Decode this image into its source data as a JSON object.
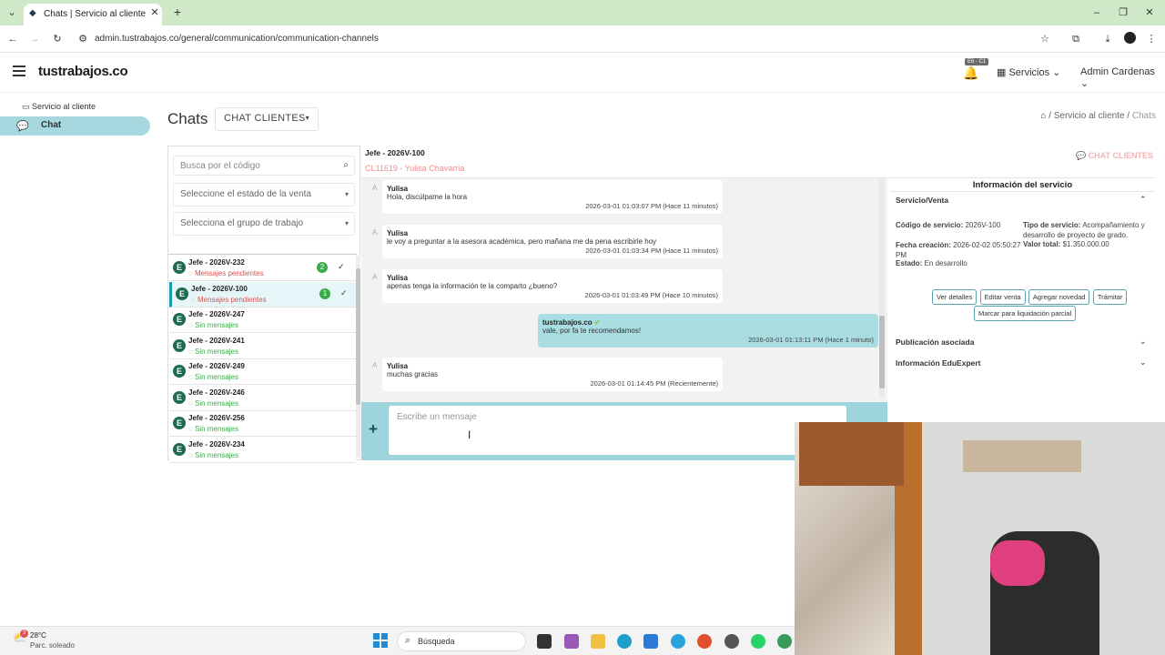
{
  "browser": {
    "tab_title": "Chats | Servicio al cliente",
    "url": "admin.tustrabajos.co/general/communication/communication-channels"
  },
  "header": {
    "logo": "tustrabajos.co",
    "notif_badge": "E6 - C1",
    "services": "Servicios",
    "user": "Admin Cardenas"
  },
  "sidebar": {
    "section": "Servicio al cliente",
    "item": "Chat"
  },
  "page": {
    "title": "Chats",
    "dropdown": "CHAT CLIENTES",
    "crumb_home": "Servicio al cliente",
    "crumb_current": "Chats"
  },
  "filters": {
    "search_placeholder": "Busca por el código",
    "sale_state": "Seleccione el estado de la venta",
    "work_group": "Selecciona el grupo de trabajo"
  },
  "chats": [
    {
      "avatar": "E",
      "name": "Jefe - 2026V-232",
      "status": "Mensajes pendientes",
      "badge": "2",
      "pending": true
    },
    {
      "avatar": "E",
      "name": "Jefe - 2026V-100",
      "status": "Mensajes pendientes",
      "badge": "1",
      "pending": true
    },
    {
      "avatar": "E",
      "name": "Jefe - 2026V-247",
      "status": "Sin mensajes",
      "badge": "",
      "pending": false
    },
    {
      "avatar": "E",
      "name": "Jefe - 2026V-241",
      "status": "Sin mensajes",
      "badge": "",
      "pending": false
    },
    {
      "avatar": "E",
      "name": "Jefe - 2026V-249",
      "status": "Sin mensajes",
      "badge": "",
      "pending": false
    },
    {
      "avatar": "E",
      "name": "Jefe - 2026V-246",
      "status": "Sin mensajes",
      "badge": "",
      "pending": false
    },
    {
      "avatar": "E",
      "name": "Jefe - 2026V-256",
      "status": "Sin mensajes",
      "badge": "",
      "pending": false
    },
    {
      "avatar": "E",
      "name": "Jefe - 2026V-234",
      "status": "Sin mensajes",
      "badge": "",
      "pending": false
    }
  ],
  "conversation": {
    "title": "Jefe - 2026V-100",
    "client": "CL11619 - Yulisa Chavarria",
    "channel_label": "CHAT CLIENTES",
    "messages": [
      {
        "marker": "A",
        "sender": "Yulisa",
        "text": "Hola, discúlpame la hora",
        "time": "2026-03-01 01:03:07 PM (Hace 11 minutos)"
      },
      {
        "marker": "A",
        "sender": "Yulisa",
        "text": "le voy a preguntar a la asesora académica, pero mañana me da pena escribirle hoy",
        "time": "2026-03-01 01:03:34 PM (Hace 11 minutos)"
      },
      {
        "marker": "A",
        "sender": "Yulisa",
        "text": "apenas tenga la información te la comparto ¿bueno?",
        "time": "2026-03-01 01:03:49 PM (Hace 10 minutos)"
      },
      {
        "marker": "",
        "sender": "tustrabajos.co",
        "text": "vale, por fa te recomendamos!",
        "time": "2026-03-01 01:13:11 PM (Hace 1 minuto)"
      },
      {
        "marker": "A",
        "sender": "Yulisa",
        "text": "muchas gracias",
        "time": "2026-03-01 01:14:45 PM (Recientemente)"
      }
    ],
    "composer_placeholder": "Escribe un mensaje"
  },
  "info": {
    "title": "Información del servicio",
    "section": "Servicio/Venta",
    "code_label": "Código de servicio:",
    "code": "2026V-100",
    "created_label": "Fecha creación:",
    "created": "2026-02-02 05:50:27 PM",
    "state_label": "Estado:",
    "state": "En desarrollo",
    "type_label": "Tipo de servicio:",
    "type": "Acompañamiento y desarrollo de proyecto de grado.",
    "total_label": "Valor total:",
    "total": "$1.350.000.00",
    "buttons": [
      "Ver detalles",
      "Editar venta",
      "Agregar novedad",
      "Trámitar"
    ],
    "partial_button": "Marcar para liquidación parcial",
    "pub": "Publicación asociada",
    "edu": "Información EduExpert"
  },
  "taskbar": {
    "temp": "28°C",
    "weather": "Parc. soleado",
    "search": "Búsqueda",
    "weather_badge": "3"
  },
  "colors": {
    "accent": "#a8d8df",
    "pending": "#d9534f",
    "ok": "#3bab4b",
    "client": "#f08c8c"
  }
}
